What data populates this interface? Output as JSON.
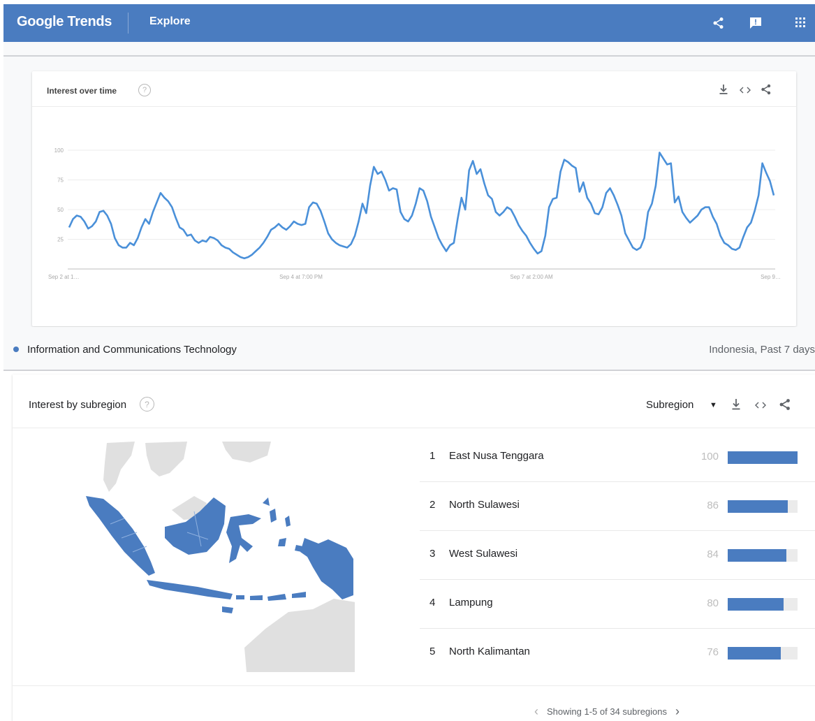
{
  "header": {
    "logo": "Google Trends",
    "section": "Explore",
    "icons": [
      "share-icon",
      "feedback-icon",
      "apps-grid-icon"
    ]
  },
  "interest_over_time": {
    "title": "Interest over time",
    "icons": [
      "help-icon",
      "download-icon",
      "embed-icon",
      "share-icon"
    ]
  },
  "chart_data": {
    "type": "line",
    "title": "",
    "xlabel": "",
    "ylabel": "",
    "ylim": [
      0,
      100
    ],
    "yticks": [
      25,
      50,
      75,
      100
    ],
    "ytick_labels": [
      "25",
      "50",
      "75",
      "100"
    ],
    "xtick_labels": [
      "Sep 2 at 1…",
      "Sep 4 at 7:00 PM",
      "Sep 7 at 2:00 AM",
      "Sep 9…"
    ],
    "grid": true,
    "color": "#4a90d9",
    "series": [
      {
        "values": [
          35,
          42,
          45,
          44,
          40,
          34,
          36,
          40,
          48,
          49,
          45,
          38,
          26,
          20,
          18,
          18,
          22,
          20,
          26,
          35,
          42,
          38,
          48,
          56,
          64,
          60,
          57,
          52,
          43,
          35,
          33,
          28,
          29,
          24,
          22,
          24,
          23,
          27,
          26,
          24,
          20,
          18,
          17,
          14,
          12,
          10,
          9,
          10,
          12,
          15,
          18,
          22,
          27,
          33,
          35,
          38,
          35,
          33,
          36,
          40,
          38,
          37,
          38,
          52,
          56,
          55,
          49,
          40,
          30,
          25,
          22,
          20,
          19,
          18,
          21,
          28,
          40,
          55,
          47,
          70,
          86,
          80,
          82,
          75,
          66,
          68,
          67,
          48,
          42,
          40,
          45,
          55,
          68,
          66,
          57,
          44,
          35,
          26,
          20,
          15,
          20,
          22,
          42,
          60,
          50,
          83,
          91,
          80,
          84,
          72,
          62,
          59,
          48,
          45,
          48,
          52,
          50,
          44,
          37,
          32,
          28,
          22,
          17,
          13,
          15,
          28,
          52,
          59,
          60,
          82,
          92,
          90,
          87,
          85,
          65,
          73,
          60,
          55,
          47,
          46,
          52,
          64,
          68,
          62,
          54,
          45,
          30,
          24,
          18,
          16,
          18,
          26,
          48,
          55,
          70,
          98,
          93,
          88,
          89,
          56,
          61,
          48,
          43,
          39,
          42,
          45,
          50,
          52,
          52,
          44,
          38,
          28,
          22,
          20,
          17,
          16,
          18,
          27,
          35,
          39,
          49,
          62,
          89,
          81,
          74,
          62
        ]
      }
    ]
  },
  "legend": {
    "term": "Information and Communications Technology",
    "meta": "Indonesia, Past 7 days"
  },
  "subregion": {
    "title": "Interest by subregion",
    "select_label": "Subregion",
    "icons": [
      "help-icon",
      "dropdown-icon",
      "download-icon",
      "embed-icon",
      "share-icon"
    ],
    "rows": [
      {
        "rank": "1",
        "name": "East Nusa Tenggara",
        "value": "100",
        "score": 100
      },
      {
        "rank": "2",
        "name": "North Sulawesi",
        "value": "86",
        "score": 86
      },
      {
        "rank": "3",
        "name": "West Sulawesi",
        "value": "84",
        "score": 84
      },
      {
        "rank": "4",
        "name": "Lampung",
        "value": "80",
        "score": 80
      },
      {
        "rank": "5",
        "name": "North Kalimantan",
        "value": "76",
        "score": 76
      }
    ],
    "pager_text": "Showing 1-5 of 34 subregions",
    "pager_icons": [
      "chevron-left-icon",
      "chevron-right-icon"
    ]
  },
  "colors": {
    "header_bg": "#4a7cc0",
    "accent": "#4a7cc0",
    "line": "#4a90d9",
    "map_gray": "#e0e0e0"
  }
}
